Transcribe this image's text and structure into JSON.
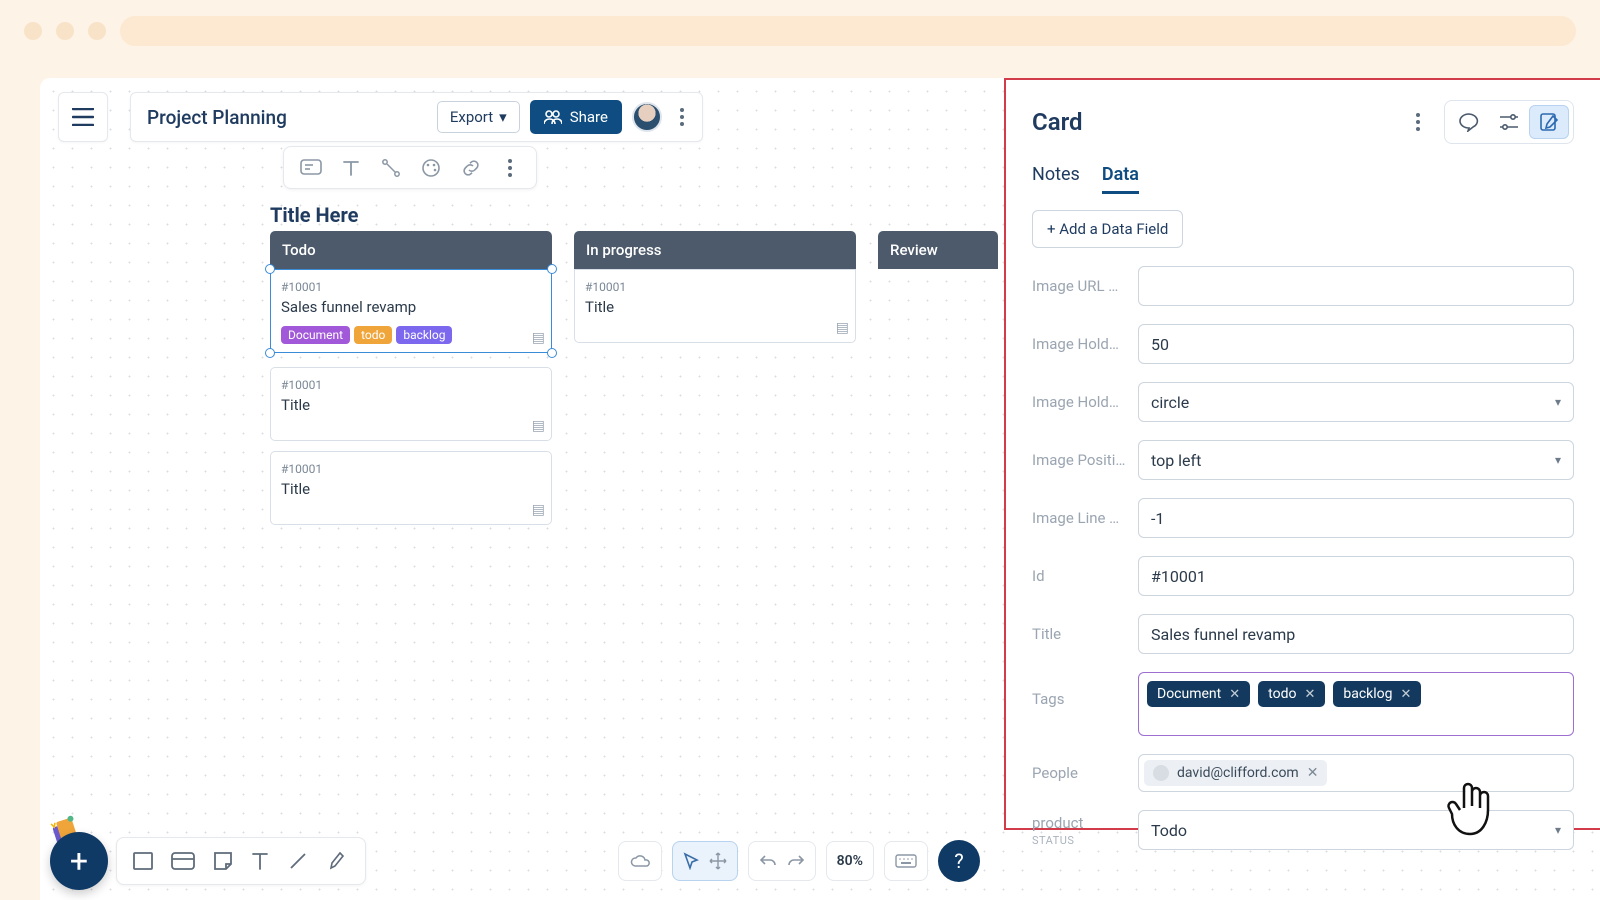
{
  "header": {
    "project_title": "Project Planning",
    "export_label": "Export",
    "share_label": "Share"
  },
  "board": {
    "title": "Title Here",
    "columns": [
      {
        "name": "Todo"
      },
      {
        "name": "In progress"
      },
      {
        "name": "Review"
      }
    ],
    "cards_col0": [
      {
        "id": "#10001",
        "title": "Sales funnel revamp",
        "tags": [
          "Document",
          "todo",
          "backlog"
        ]
      },
      {
        "id": "#10001",
        "title": "Title"
      },
      {
        "id": "#10001",
        "title": "Title"
      }
    ],
    "cards_col1": [
      {
        "id": "#10001",
        "title": "Title"
      }
    ]
  },
  "bottom": {
    "zoom": "80%"
  },
  "panel": {
    "title": "Card",
    "tabs": {
      "notes": "Notes",
      "data": "Data"
    },
    "add_field": "+ Add a Data Field",
    "fields": {
      "image_url": {
        "label": "Image URL …",
        "value": ""
      },
      "image_hold": {
        "label": "Image Hold…",
        "value": "50"
      },
      "image_hold2": {
        "label": "Image Hold…",
        "value": "circle"
      },
      "image_pos": {
        "label": "Image Positi…",
        "value": "top left"
      },
      "image_line": {
        "label": "Image Line …",
        "value": "-1"
      },
      "id": {
        "label": "Id",
        "value": "#10001"
      },
      "title": {
        "label": "Title",
        "value": "Sales funnel revamp"
      },
      "tags": {
        "label": "Tags",
        "values": [
          "Document",
          "todo",
          "backlog"
        ]
      },
      "people": {
        "label": "People",
        "value": "david@clifford.com"
      },
      "product": {
        "label": "product",
        "sublabel": "STATUS",
        "value": "Todo"
      }
    }
  }
}
